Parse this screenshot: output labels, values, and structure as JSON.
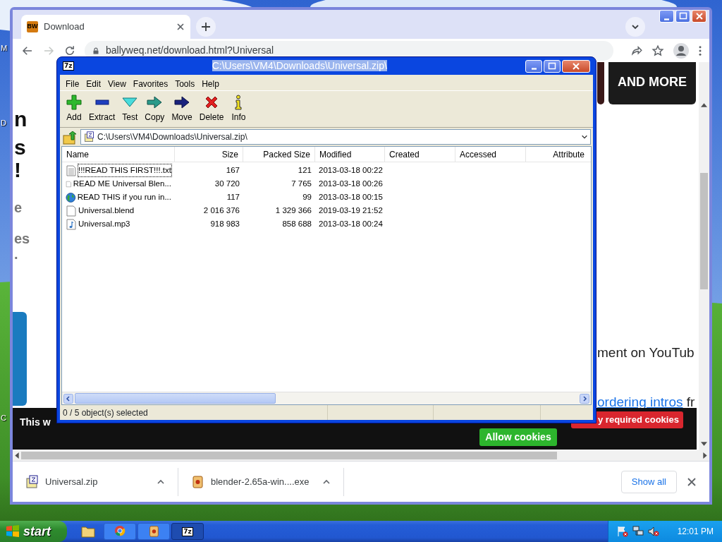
{
  "desktop": {
    "icon_labels": [
      "M",
      "D",
      "C"
    ]
  },
  "browser": {
    "tabs": [
      {
        "title": "Download",
        "favicon_text": "BW",
        "selected": true
      }
    ],
    "can_go_forward": false,
    "address": "ballyweq.net/download.html?Universal",
    "page": {
      "headline_fragments": [
        {
          "text": "n",
          "kind": "heading"
        },
        {
          "text": "s",
          "kind": "heading"
        },
        {
          "text": "!",
          "kind": "heading"
        },
        {
          "text": "e",
          "kind": "muted"
        },
        {
          "text": "es",
          "kind": "muted"
        },
        {
          "text": ".",
          "kind": "muted"
        }
      ],
      "tile_text": "AND MORE",
      "comment_fragment": "ment on YouTub",
      "link": "ordering intros",
      "link_tail": "fr",
      "cookie_banner": {
        "text": "This w",
        "buttons": [
          {
            "label": "y required cookies",
            "kind": "deny"
          },
          {
            "label": "Allow cookies",
            "kind": "allow"
          }
        ]
      }
    },
    "downloads": [
      {
        "name": "Universal.zip",
        "kind": "archive"
      },
      {
        "name": "blender-2.65a-win....exe",
        "kind": "installer"
      }
    ],
    "show_all": "Show all"
  },
  "archive_window": {
    "icon_text": "7z",
    "title": "C:\\Users\\VM4\\Downloads\\Universal.zip\\",
    "title_selected": true,
    "menu": [
      "File",
      "Edit",
      "View",
      "Favorites",
      "Tools",
      "Help"
    ],
    "toolbar": [
      {
        "label": "Add",
        "kind": "add"
      },
      {
        "label": "Extract",
        "kind": "extract"
      },
      {
        "label": "Test",
        "kind": "test"
      },
      {
        "label": "Copy",
        "kind": "copy"
      },
      {
        "label": "Move",
        "kind": "move"
      },
      {
        "label": "Delete",
        "kind": "delete"
      },
      {
        "label": "Info",
        "kind": "info"
      }
    ],
    "path": "C:\\Users\\VM4\\Downloads\\Universal.zip\\",
    "columns": [
      "Name",
      "Size",
      "Packed Size",
      "Modified",
      "Created",
      "Accessed",
      "Attribute"
    ],
    "rows": [
      {
        "kind": "text",
        "focused": true,
        "cells": [
          "!!!READ THIS FIRST!!!.txt",
          "167",
          "121",
          "2013-03-18 00:22"
        ]
      },
      {
        "kind": "file",
        "focused": false,
        "cells": [
          "READ ME Universal Blen...",
          "30 720",
          "7 765",
          "2013-03-18 00:26"
        ]
      },
      {
        "kind": "web",
        "focused": false,
        "cells": [
          "READ THIS if you run in...",
          "117",
          "99",
          "2013-03-18 00:15"
        ]
      },
      {
        "kind": "file",
        "focused": false,
        "cells": [
          "Universal.blend",
          "2 016 376",
          "1 329 366",
          "2019-03-19 21:52"
        ]
      },
      {
        "kind": "audio",
        "focused": false,
        "cells": [
          "Universal.mp3",
          "918 983",
          "858 688",
          "2013-03-18 00:24"
        ]
      }
    ],
    "status": "0 / 5 object(s) selected"
  },
  "taskbar": {
    "start": "start",
    "tasks": [
      {
        "kind": "browser",
        "active": false
      },
      {
        "kind": "installer",
        "active": false
      },
      {
        "kind": "archive",
        "active": true,
        "text": "7z"
      }
    ],
    "clock": "12:01 PM"
  }
}
